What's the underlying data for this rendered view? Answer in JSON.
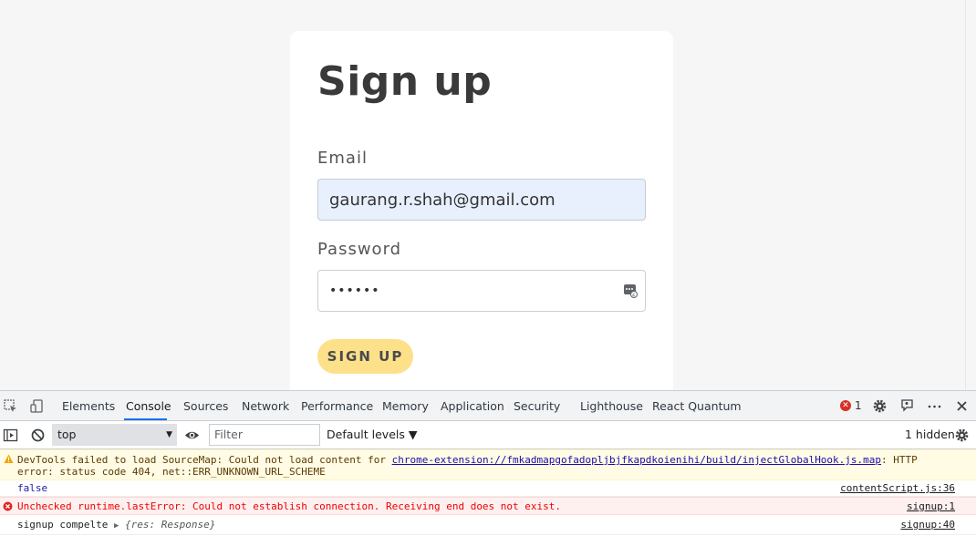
{
  "form": {
    "title": "Sign up",
    "email_label": "Email",
    "email_value": "gaurang.r.shah@gmail.com",
    "password_label": "Password",
    "password_value": "••••••",
    "submit_label": "SIGN UP"
  },
  "devtools": {
    "tabs": [
      "Elements",
      "Console",
      "Sources",
      "Network",
      "Performance",
      "Memory",
      "Application",
      "Security",
      "Lighthouse",
      "React Quantum"
    ],
    "active_tab": "Console",
    "error_count": "1",
    "context": "top",
    "filter_placeholder": "Filter",
    "levels": "Default levels ▼",
    "hidden": "1 hidden",
    "messages": {
      "warning_pre": "DevTools failed to load SourceMap: Could not load content for ",
      "warning_link": "chrome-extension://fmkadmapgofadopljbjfkapdkoienihi/build/injectGlobalHook.js.map",
      "warning_post": ": HTTP error: status code 404, net::ERR_UNKNOWN_URL_SCHEME",
      "false_text": "false",
      "false_src": "contentScript.js:36",
      "error_text": "Unchecked runtime.lastError: Could not establish connection. Receiving end does not exist.",
      "error_src": "signup:1",
      "log_text": "signup compelte ",
      "log_obj": "{res: Response}",
      "log_src": "signup:40"
    }
  },
  "colors": {
    "accent": "#1a73e8",
    "button": "#fde08a",
    "autofill": "#e8f0fe",
    "error": "#d93025"
  }
}
